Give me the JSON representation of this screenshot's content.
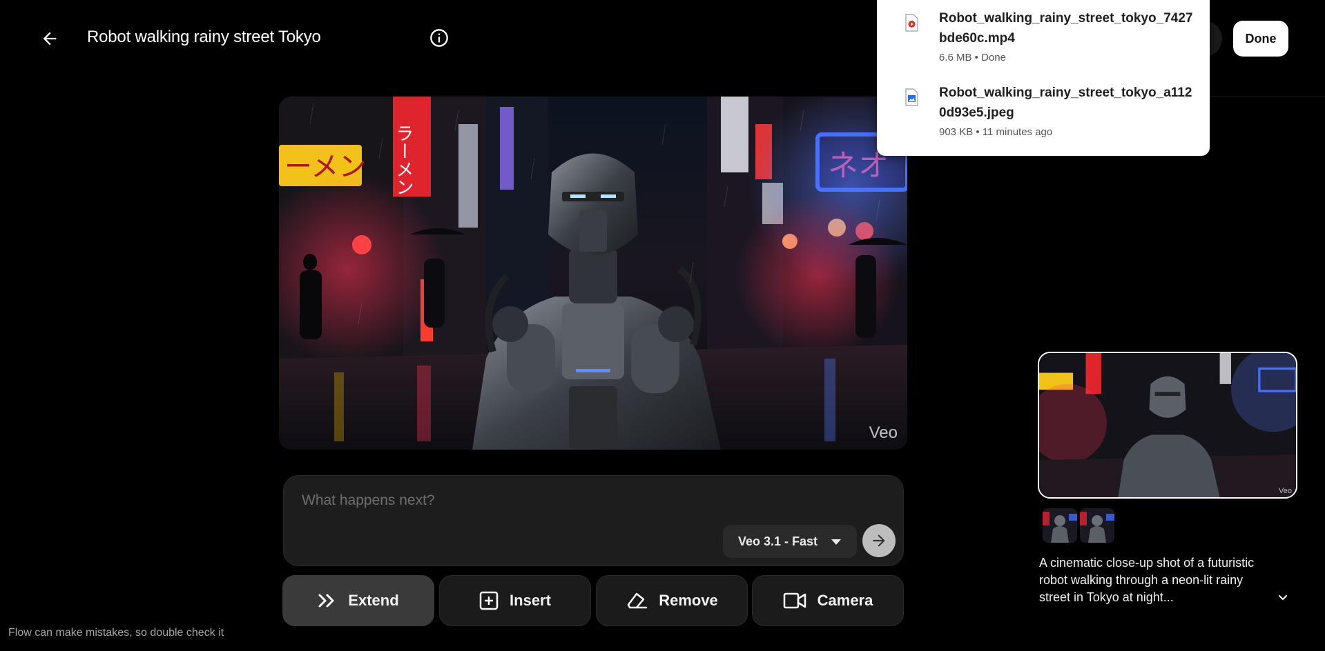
{
  "header": {
    "title": "Robot walking rainy street Tokyo",
    "done_label": "Done"
  },
  "downloads": [
    {
      "name": "Robot_walking_rainy_street_tokyo_7427bde60c.mp4",
      "meta": "6.6 MB • Done",
      "icon": "video-file-icon"
    },
    {
      "name": "Robot_walking_rainy_street_tokyo_a1120d93e5.jpeg",
      "meta": "903 KB • 11 minutes ago",
      "icon": "image-file-icon"
    }
  ],
  "media": {
    "watermark": "Veo"
  },
  "prompt": {
    "placeholder": "What happens next?",
    "value": "",
    "model": "Veo 3.1 - Fast"
  },
  "actions": [
    {
      "label": "Extend",
      "icon": "double-chevron-right-icon",
      "active": true
    },
    {
      "label": "Insert",
      "icon": "plus-square-icon",
      "active": false
    },
    {
      "label": "Remove",
      "icon": "eraser-icon",
      "active": false
    },
    {
      "label": "Camera",
      "icon": "video-camera-icon",
      "active": false
    }
  ],
  "disclaimer": "Flow can make mistakes, so double check it",
  "right_panel": {
    "description": "A cinematic close-up shot of a futuristic robot walking through a neon-lit rainy street in Tokyo at night...",
    "thumb_watermark": "Veo"
  },
  "colors": {
    "background": "#000000",
    "surface": "#1d1d1d",
    "accent_active": "#3a3a3a",
    "neon_pink": "#ff2d6f",
    "neon_blue": "#2f5bff",
    "neon_yellow": "#f5c400"
  }
}
